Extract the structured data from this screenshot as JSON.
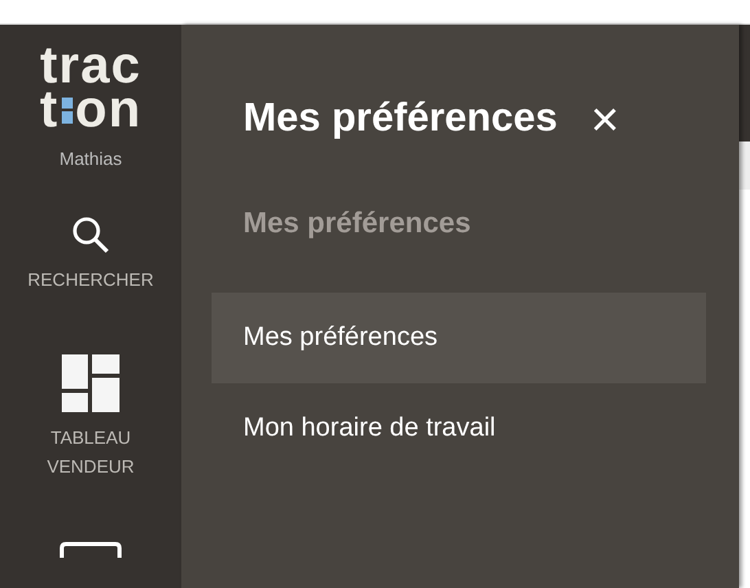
{
  "sidebar": {
    "logo": {
      "line_1": "trac",
      "line_2_start": "t",
      "line_2_end": "on"
    },
    "user": "Mathias",
    "items": [
      {
        "kind": "search",
        "label": "RECHERCHER"
      },
      {
        "kind": "dashboard",
        "label": "TABLEAU VENDEUR"
      },
      {
        "kind": "screen"
      }
    ]
  },
  "panel": {
    "title": "Mes préférences",
    "close": "×",
    "section": "Mes préférences",
    "items": [
      {
        "label": "Mes préférences",
        "selected": true
      },
      {
        "label": "Mon horaire de travail",
        "selected": false
      }
    ]
  }
}
